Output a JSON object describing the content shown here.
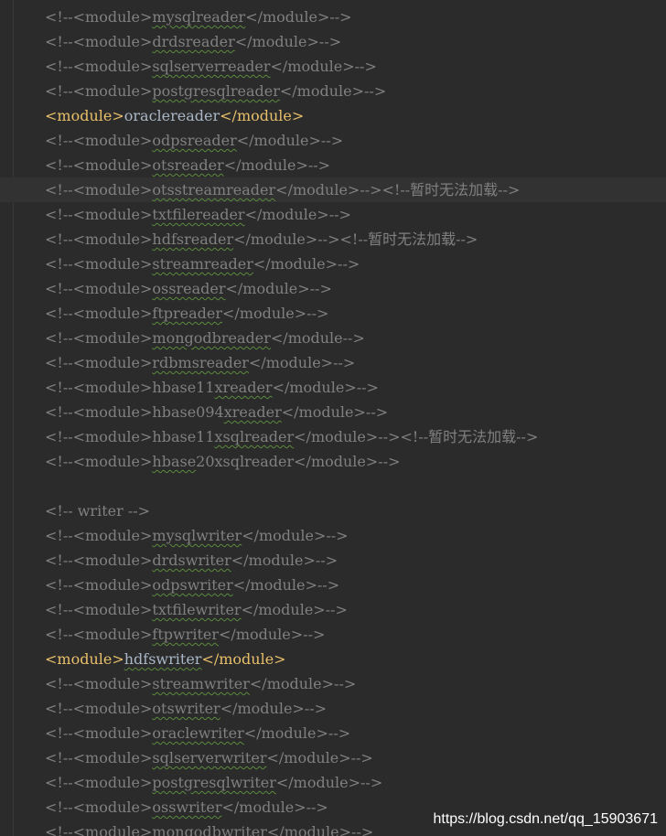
{
  "current_line_index": 7,
  "lines": [
    [
      {
        "t": "<!--<module>",
        "k": "c"
      },
      {
        "t": "mysqlreader",
        "k": "c",
        "w": 1
      },
      {
        "t": "</module>-->",
        "k": "c"
      }
    ],
    [
      {
        "t": "<!--<module>",
        "k": "c"
      },
      {
        "t": "drdsreader",
        "k": "c",
        "w": 1
      },
      {
        "t": "</module>-->",
        "k": "c"
      }
    ],
    [
      {
        "t": "<!--<module>",
        "k": "c"
      },
      {
        "t": "sqlserverreader",
        "k": "c",
        "w": 1
      },
      {
        "t": "</module>-->",
        "k": "c"
      }
    ],
    [
      {
        "t": "<!--<module>",
        "k": "c"
      },
      {
        "t": "postgresqlreader",
        "k": "c",
        "w": 1
      },
      {
        "t": "</module>-->",
        "k": "c"
      }
    ],
    [
      {
        "t": "<module>",
        "k": "t"
      },
      {
        "t": "oraclereader",
        "k": "x"
      },
      {
        "t": "</module>",
        "k": "t"
      }
    ],
    [
      {
        "t": "<!--<module>",
        "k": "c"
      },
      {
        "t": "odpsreader",
        "k": "c",
        "w": 1
      },
      {
        "t": "</module>-->",
        "k": "c"
      }
    ],
    [
      {
        "t": "<!--<module>",
        "k": "c"
      },
      {
        "t": "otsreader",
        "k": "c",
        "w": 1
      },
      {
        "t": "</module>-->",
        "k": "c"
      }
    ],
    [
      {
        "t": "<!--<module>",
        "k": "c"
      },
      {
        "t": "otsstreamreader",
        "k": "c",
        "w": 1
      },
      {
        "t": "</module>--><!--暂时无法加载-->",
        "k": "c"
      }
    ],
    [
      {
        "t": "<!--<module>",
        "k": "c"
      },
      {
        "t": "txtfilereader",
        "k": "c",
        "w": 1
      },
      {
        "t": "</module>-->",
        "k": "c"
      }
    ],
    [
      {
        "t": "<!--<module>",
        "k": "c"
      },
      {
        "t": "hdfsreader",
        "k": "c",
        "w": 1
      },
      {
        "t": "</module>--><!--暂时无法加载-->",
        "k": "c"
      }
    ],
    [
      {
        "t": "<!--<module>",
        "k": "c"
      },
      {
        "t": "streamreader",
        "k": "c",
        "w": 1
      },
      {
        "t": "</module>-->",
        "k": "c"
      }
    ],
    [
      {
        "t": "<!--<module>",
        "k": "c"
      },
      {
        "t": "ossreader",
        "k": "c",
        "w": 1
      },
      {
        "t": "</module>-->",
        "k": "c"
      }
    ],
    [
      {
        "t": "<!--<module>",
        "k": "c"
      },
      {
        "t": "ftpreader",
        "k": "c",
        "w": 1
      },
      {
        "t": "</module>-->",
        "k": "c"
      }
    ],
    [
      {
        "t": "<!--<module>",
        "k": "c"
      },
      {
        "t": "mongodbreader",
        "k": "c",
        "w": 1
      },
      {
        "t": "</module-->",
        "k": "c"
      }
    ],
    [
      {
        "t": "<!--<module>",
        "k": "c"
      },
      {
        "t": "rdbmsreader",
        "k": "c",
        "w": 1
      },
      {
        "t": "</module>-->",
        "k": "c"
      }
    ],
    [
      {
        "t": "<!--<module>",
        "k": "c"
      },
      {
        "t": "hbase11",
        "k": "c"
      },
      {
        "t": "xreader",
        "k": "c",
        "w": 1
      },
      {
        "t": "</module>-->",
        "k": "c"
      }
    ],
    [
      {
        "t": "<!--<module>",
        "k": "c"
      },
      {
        "t": "hbase094",
        "k": "c"
      },
      {
        "t": "xreader",
        "k": "c",
        "w": 1
      },
      {
        "t": "</module>-->",
        "k": "c"
      }
    ],
    [
      {
        "t": "<!--<module>",
        "k": "c"
      },
      {
        "t": "hbase11",
        "k": "c"
      },
      {
        "t": "xsqlreader",
        "k": "c",
        "w": 1
      },
      {
        "t": "</module>--><!--暂时无法加载-->",
        "k": "c"
      }
    ],
    [
      {
        "t": "<!--<module>",
        "k": "c"
      },
      {
        "t": "hbase",
        "k": "c",
        "w": 1
      },
      {
        "t": "20xsqlreader</module>-->",
        "k": "c"
      }
    ],
    [],
    [
      {
        "t": "<!-- writer -->",
        "k": "c"
      }
    ],
    [
      {
        "t": "<!--<module>",
        "k": "c"
      },
      {
        "t": "mysqlwriter",
        "k": "c",
        "w": 1
      },
      {
        "t": "</module>-->",
        "k": "c"
      }
    ],
    [
      {
        "t": "<!--<module>",
        "k": "c"
      },
      {
        "t": "drdswriter",
        "k": "c",
        "w": 1
      },
      {
        "t": "</module>-->",
        "k": "c"
      }
    ],
    [
      {
        "t": "<!--<module>",
        "k": "c"
      },
      {
        "t": "odpswriter",
        "k": "c",
        "w": 1
      },
      {
        "t": "</module>-->",
        "k": "c"
      }
    ],
    [
      {
        "t": "<!--<module>",
        "k": "c"
      },
      {
        "t": "txtfilewriter",
        "k": "c",
        "w": 1
      },
      {
        "t": "</module>-->",
        "k": "c"
      }
    ],
    [
      {
        "t": "<!--<module>",
        "k": "c"
      },
      {
        "t": "ftpwriter",
        "k": "c",
        "w": 1
      },
      {
        "t": "</module>-->",
        "k": "c"
      }
    ],
    [
      {
        "t": "<module>",
        "k": "t"
      },
      {
        "t": "hdfswriter",
        "k": "x",
        "w": 1
      },
      {
        "t": "</module>",
        "k": "t"
      }
    ],
    [
      {
        "t": "<!--<module>",
        "k": "c"
      },
      {
        "t": "streamwriter",
        "k": "c",
        "w": 1
      },
      {
        "t": "</module>-->",
        "k": "c"
      }
    ],
    [
      {
        "t": "<!--<module>",
        "k": "c"
      },
      {
        "t": "otswriter",
        "k": "c",
        "w": 1
      },
      {
        "t": "</module>-->",
        "k": "c"
      }
    ],
    [
      {
        "t": "<!--<module>",
        "k": "c"
      },
      {
        "t": "oraclewriter",
        "k": "c",
        "w": 1
      },
      {
        "t": "</module>-->",
        "k": "c"
      }
    ],
    [
      {
        "t": "<!--<module>",
        "k": "c"
      },
      {
        "t": "sqlserverwriter",
        "k": "c",
        "w": 1
      },
      {
        "t": "</module>-->",
        "k": "c"
      }
    ],
    [
      {
        "t": "<!--<module>",
        "k": "c"
      },
      {
        "t": "postgresqlwriter",
        "k": "c",
        "w": 1
      },
      {
        "t": "</module>-->",
        "k": "c"
      }
    ],
    [
      {
        "t": "<!--<module>",
        "k": "c"
      },
      {
        "t": "osswriter",
        "k": "c",
        "w": 1
      },
      {
        "t": "</module>-->",
        "k": "c"
      }
    ],
    [
      {
        "t": "<!--<module>",
        "k": "c"
      },
      {
        "t": "mongodbwriter",
        "k": "c",
        "w": 1
      },
      {
        "t": "</module>-->",
        "k": "c"
      }
    ]
  ],
  "watermark": "https://blog.csdn.net/qq_15903671",
  "colors": {
    "background": "#2b2b2b",
    "current_line": "#323232",
    "comment": "#808080",
    "tag": "#e8bf6a",
    "text": "#a9b7c6",
    "typo_underline": "#5a8a3c"
  }
}
